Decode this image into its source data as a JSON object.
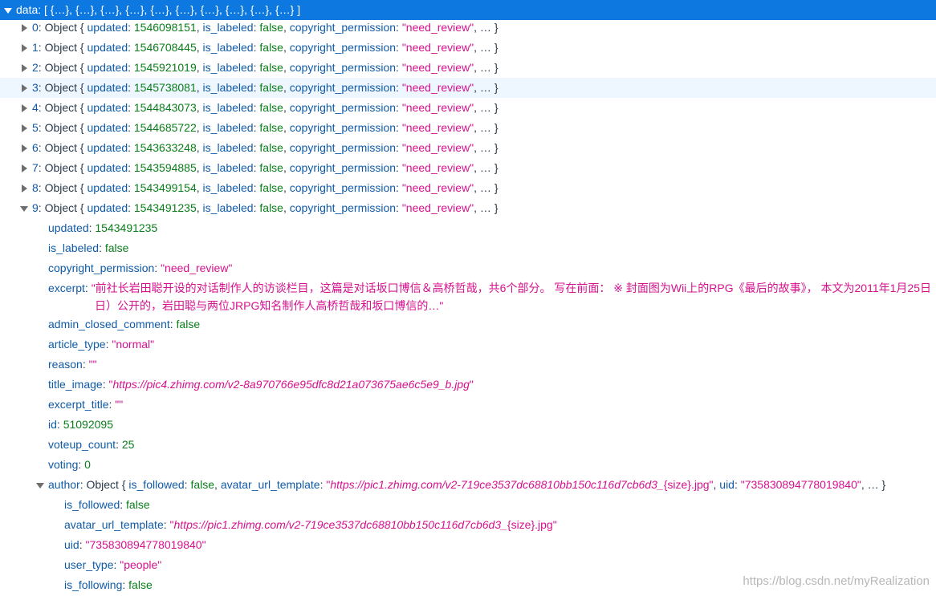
{
  "root": {
    "key": "data",
    "preview": "[ {…}, {…}, {…}, {…}, {…}, {…}, {…}, {…}, {…}, {…} ]"
  },
  "items": [
    {
      "index": "0",
      "updated": "1546098151"
    },
    {
      "index": "1",
      "updated": "1546708445"
    },
    {
      "index": "2",
      "updated": "1545921019"
    },
    {
      "index": "3",
      "updated": "1545738081"
    },
    {
      "index": "4",
      "updated": "1544843073"
    },
    {
      "index": "5",
      "updated": "1544685722"
    },
    {
      "index": "6",
      "updated": "1543633248"
    },
    {
      "index": "7",
      "updated": "1543594885"
    },
    {
      "index": "8",
      "updated": "1543499154"
    },
    {
      "index": "9",
      "updated": "1543491235"
    }
  ],
  "common": {
    "object_label": "Object {",
    "updated_key": "updated",
    "is_labeled_key": "is_labeled",
    "is_labeled_val": "false",
    "copyright_key": "copyright_permission",
    "copyright_val": "\"need_review\"",
    "ellipsis": ", … }"
  },
  "expanded": {
    "updated": {
      "key": "updated",
      "value": "1543491235"
    },
    "is_labeled": {
      "key": "is_labeled",
      "value": "false"
    },
    "copyright_permission": {
      "key": "copyright_permission",
      "value": "\"need_review\""
    },
    "excerpt": {
      "key": "excerpt",
      "line1": "\"前社长岩田聪开设的对话制作人的访谈栏目，这篇是对话坂口博信＆高桥哲哉，共6个部分。 写在前面： ※ 封面图为Wii上的RPG《最后的故事》， 本文为2011年1月25日",
      "line2": "日）公开的，岩田聪与两位JRPG知名制作人高桥哲哉和坂口博信的…\""
    },
    "admin_closed_comment": {
      "key": "admin_closed_comment",
      "value": "false"
    },
    "article_type": {
      "key": "article_type",
      "value": "\"normal\""
    },
    "reason": {
      "key": "reason",
      "value": "\"\""
    },
    "title_image": {
      "key": "title_image",
      "q1": "\"",
      "url": "https://pic4.zhimg.com/v2-8a970766e95dfc8d21a073675ae6c5e9_b.jpg",
      "q2": "\""
    },
    "excerpt_title": {
      "key": "excerpt_title",
      "value": "\"\""
    },
    "id": {
      "key": "id",
      "value": "51092095"
    },
    "voteup_count": {
      "key": "voteup_count",
      "value": "25"
    },
    "voting": {
      "key": "voting",
      "value": "0"
    },
    "author": {
      "key": "author",
      "object_label": "Object {",
      "is_followed_key": "is_followed",
      "is_followed_val": "false",
      "avatar_key": "avatar_url_template",
      "avatar_q1": "\"",
      "avatar_url": "https://pic1.zhimg.com/v2-719ce3537dc68810bb150c116d7cb6d3_",
      "avatar_suffix": "{size}.jpg\"",
      "uid_key": "uid",
      "uid_val": "\"735830894778019840\"",
      "ellipsis": ", … }",
      "children": {
        "is_followed": {
          "key": "is_followed",
          "value": "false"
        },
        "avatar_url_template": {
          "key": "avatar_url_template",
          "q1": "\"",
          "url": "https://pic1.zhimg.com/v2-719ce3537dc68810bb150c116d7cb6d3_",
          "suffix": "{size}.jpg\""
        },
        "uid": {
          "key": "uid",
          "value": "\"735830894778019840\""
        },
        "user_type": {
          "key": "user_type",
          "value": "\"people\""
        },
        "is_following": {
          "key": "is_following",
          "value": "false"
        }
      }
    }
  },
  "watermark": "https://blog.csdn.net/myRealization"
}
